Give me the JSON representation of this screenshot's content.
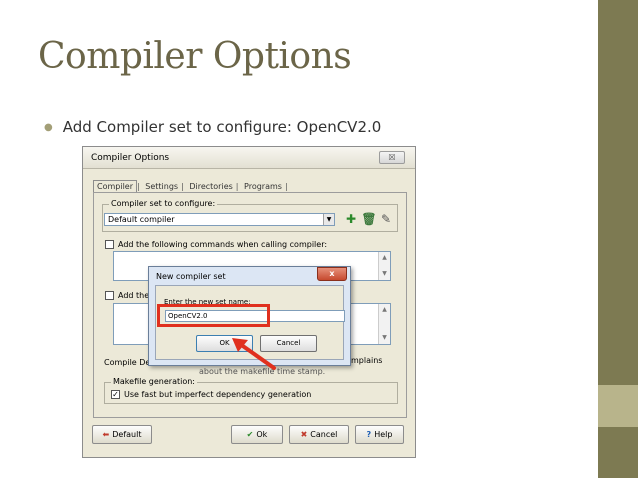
{
  "slide": {
    "title": "Compiler Options",
    "bullet": "Add Compiler set to configure: OpenCV2.0"
  },
  "dialog": {
    "title": "Compiler Options",
    "close_label": "☒",
    "tabs": [
      "Compiler",
      "Settings",
      "Directories",
      "Programs"
    ],
    "compiler_set_label": "Compiler set to configure:",
    "compiler_set_value": "Default compiler",
    "add_commands_compiler_label": "Add the following commands when calling compiler:",
    "add_commands_linker_label_visible": "Add thes",
    "compile_delay_label_visible": "Compile Dela",
    "delay_value_visible": "",
    "complains_visible": "mplains",
    "makefile_tip_visible": "about the makefile time stamp.",
    "makefile_group_label": "Makefile generation:",
    "makefile_option_label": "Use fast but imperfect dependency generation",
    "makefile_option_checked": true,
    "default_button": "Default",
    "ok_button": "Ok",
    "cancel_button": "Cancel",
    "help_button": "Help"
  },
  "new_set_dialog": {
    "title": "New compiler set",
    "close_label": "x",
    "prompt": "Enter the new set name:",
    "input_value": "OpenCV2.0",
    "ok_button": "OK",
    "cancel_button": "Cancel"
  },
  "colors": {
    "accent_bar": "#7d7a52",
    "title_color": "#6b6548",
    "highlight": "#e0301e"
  }
}
